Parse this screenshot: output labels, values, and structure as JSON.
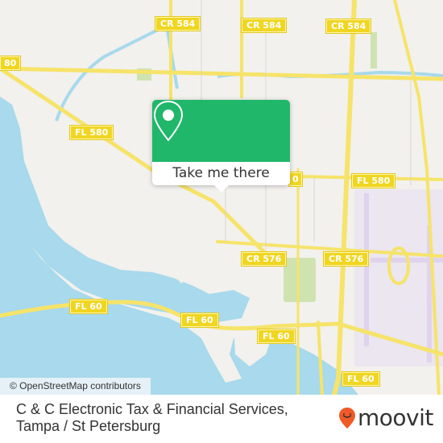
{
  "map": {
    "road_labels": [
      {
        "id": "cr584-a",
        "text": "CR 584"
      },
      {
        "id": "cr584-b",
        "text": "CR 584"
      },
      {
        "id": "cr584-c",
        "text": "CR 584"
      },
      {
        "id": "fl580-west",
        "text": "FL 580"
      },
      {
        "id": "fl580-partial-left",
        "text": "80"
      },
      {
        "id": "fl580-partial-mid",
        "text": "0"
      },
      {
        "id": "fl580-east",
        "text": "FL 580"
      },
      {
        "id": "cr576-a",
        "text": "CR 576"
      },
      {
        "id": "cr576-b",
        "text": "CR 576"
      },
      {
        "id": "fl60-a",
        "text": "FL 60"
      },
      {
        "id": "fl60-b",
        "text": "FL 60"
      },
      {
        "id": "fl60-c",
        "text": "FL 60"
      },
      {
        "id": "fl60-d",
        "text": "FL 60"
      }
    ],
    "colors": {
      "land": "#f2f1ed",
      "water": "#a8d9ec",
      "road": "#f6e36a",
      "park": "#cfe3b0",
      "airport": "#e6dcef",
      "popup": "#21b76b"
    }
  },
  "popup": {
    "icon": "location-pin-icon",
    "button_label": "Take me there"
  },
  "attribution": "© OpenStreetMap contributors",
  "footer": {
    "title": "C & C Electronic Tax & Financial Services, Tampa / St Petersburg",
    "brand": "moovit",
    "brand_color": "#f05a28"
  }
}
